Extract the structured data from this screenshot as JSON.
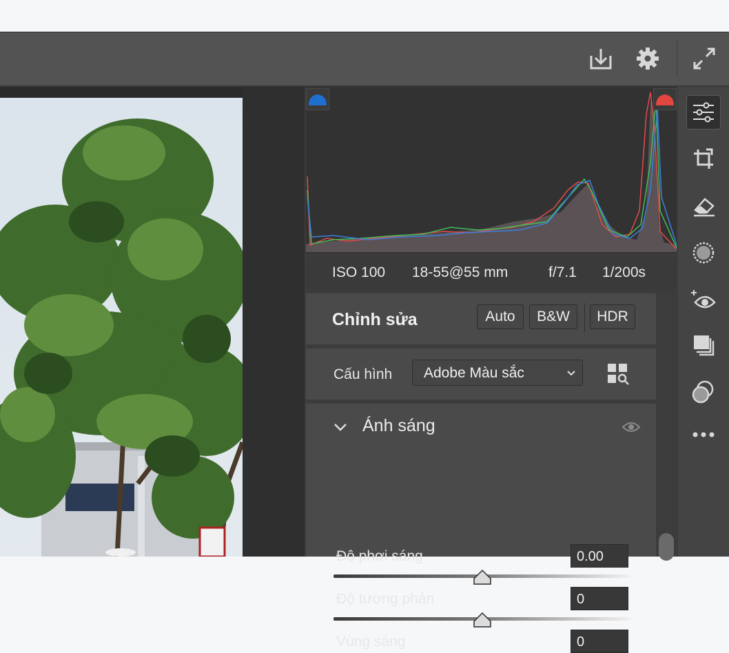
{
  "toolbar": {
    "icons": [
      "save-icon",
      "gear-icon",
      "expand-icon"
    ]
  },
  "exif": {
    "iso": "ISO 100",
    "lens": "18-55@55 mm",
    "aperture": "f/7.1",
    "shutter": "1/200s"
  },
  "edit": {
    "title": "Chỉnh sửa",
    "auto_label": "Auto",
    "bw_label": "B&W",
    "hdr_label": "HDR"
  },
  "profile": {
    "label": "Cấu hình",
    "value": "Adobe Màu sắc"
  },
  "light": {
    "title": "Ánh sáng",
    "sliders": [
      {
        "label": "Độ phơi sáng",
        "value": "0.00",
        "position": 0.5
      },
      {
        "label": "Độ tương phản",
        "value": "0",
        "position": 0.5
      },
      {
        "label": "Vùng sáng",
        "value": "0",
        "position": 0.5
      }
    ]
  },
  "colors": {
    "accent_blue": "#1f6fd1",
    "accent_red": "#e2473f",
    "panel_bg": "#4a4a4a"
  },
  "rail_icons": [
    "edit-sliders-icon",
    "crop-icon",
    "eraser-icon",
    "mask-icon",
    "redeye-icon",
    "presets-icon",
    "snapshots-icon",
    "more-icon"
  ]
}
